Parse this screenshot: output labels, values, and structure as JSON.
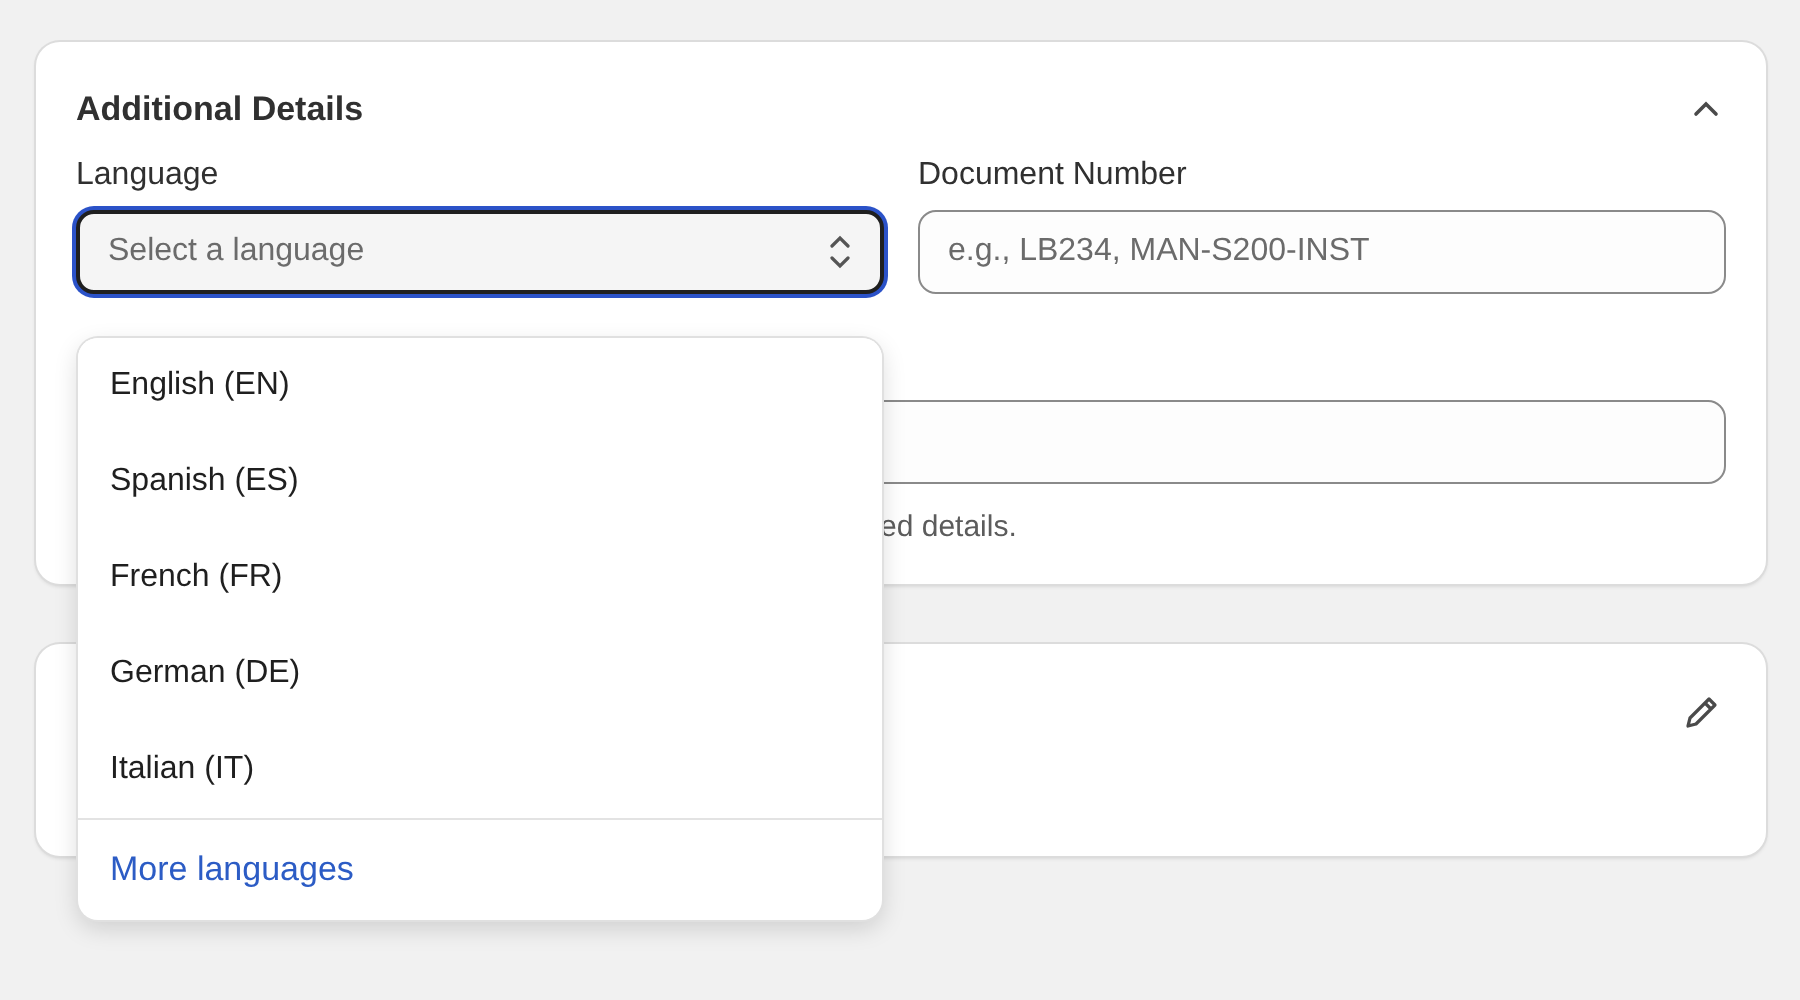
{
  "details_card": {
    "title": "Additional Details",
    "expanded": true,
    "language": {
      "label": "Language",
      "placeholder": "Select a language",
      "open": true
    },
    "document_number": {
      "label": "Document Number",
      "placeholder": "e.g., LB234, MAN-S200-INST"
    },
    "helper_text": "ed details."
  },
  "language_menu": {
    "options": [
      {
        "label": "English (EN)",
        "selected": false
      },
      {
        "label": "Spanish (ES)",
        "selected": false
      },
      {
        "label": "French (FR)",
        "selected": false
      },
      {
        "label": "German (DE)",
        "selected": false
      },
      {
        "label": "Italian (IT)",
        "selected": false
      }
    ],
    "more_link": "More languages"
  }
}
